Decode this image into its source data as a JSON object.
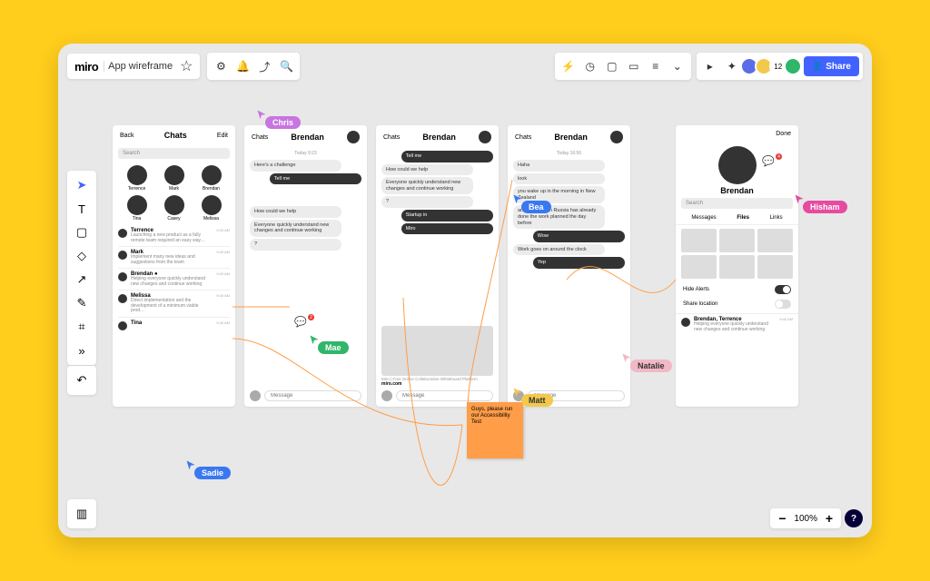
{
  "brand": "miro",
  "board": "App wireframe",
  "zoom": "100%",
  "share": "Share",
  "avatar_count": "12",
  "search_ph": "Search",
  "msg_ph": "Message",
  "cursors": {
    "chris": {
      "label": "Chris",
      "color": "#C875E0"
    },
    "mae": {
      "label": "Mae",
      "color": "#2FB66A"
    },
    "bea": {
      "label": "Bea",
      "color": "#3A78F2"
    },
    "matt": {
      "label": "Matt",
      "color": "#F2C94C"
    },
    "natalie": {
      "label": "Natalie",
      "color": "#F2B8C6"
    },
    "hisham": {
      "label": "Hisham",
      "color": "#E64BA0"
    },
    "sadie": {
      "label": "Sadie",
      "color": "#3A78F2"
    }
  },
  "sticky": "Guys, please run our Accessibility Test",
  "f1": {
    "back": "Back",
    "title": "Chats",
    "edit": "Edit",
    "people": [
      "Terrence",
      "Mark",
      "Brendan",
      "Tina",
      "Casey",
      "Melissa"
    ],
    "items": [
      {
        "n": "Terrence",
        "s": "Launching a new product as a fully remote team required an easy way…",
        "t": "9:33 AM"
      },
      {
        "n": "Mark",
        "s": "Implement many new ideas and suggestions from the team",
        "t": "9:40 AM"
      },
      {
        "n": "Brendan ●",
        "s": "Helping everyone quickly understand new changes and continue working",
        "t": "9:40 AM"
      },
      {
        "n": "Melissa",
        "s": "Direct implementation and the development of a minimum viable prod…",
        "t": "9:40 AM"
      },
      {
        "n": "Tina",
        "s": "",
        "t": "9:40 AM"
      }
    ]
  },
  "f2": {
    "back": "Chats",
    "title": "Brendan",
    "ts": "Today 9:23",
    "m": [
      "Here's a challenge",
      "Tell me",
      "How could we help",
      "Everyone quickly understand new changes and continue working",
      "?"
    ]
  },
  "f3": {
    "back": "Chats",
    "title": "Brendan",
    "m": [
      "Tell me",
      "How could we help",
      "Everyone quickly understand new changes and continue working",
      "?",
      "Startup in",
      "Miro"
    ],
    "cap": "Miro | Free Online Collaborative Whiteboard Platform",
    "link": "miro.com"
  },
  "f4": {
    "back": "Chats",
    "title": "Brendan",
    "ts": "Today 16:56",
    "m": [
      "Haha",
      "look",
      "you wake up in the morning in New Zealand",
      "and the team in Russia has already done the work planned the day before",
      "Wow",
      "Work goes on around the clock",
      "Yep"
    ]
  },
  "f5": {
    "done": "Done",
    "name": "Brendan",
    "tabs": [
      "Messages",
      "Files",
      "Links"
    ],
    "s1": "Hide Alerts",
    "s2": "Share location",
    "item": {
      "n": "Brendan, Terrence",
      "s": "Helping everyone quickly understand new changes and continue working",
      "t": "9:40 AM"
    }
  }
}
